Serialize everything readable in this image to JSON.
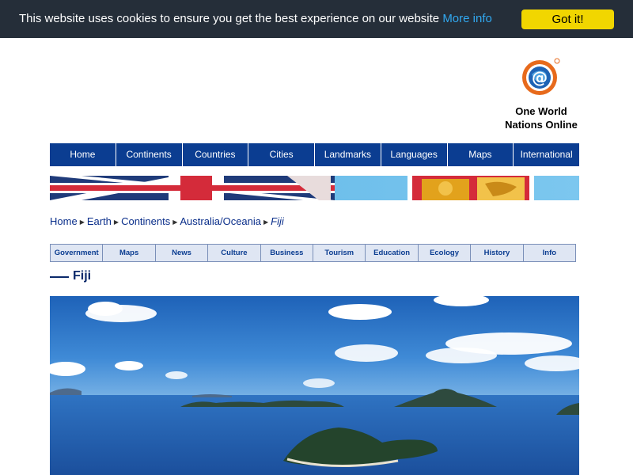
{
  "cookie_bar": {
    "message": "This website uses cookies to ensure you get the best experience on our website",
    "more_info": "More info",
    "button": "Got it!"
  },
  "logo": {
    "line1": "One World",
    "line2": "Nations Online"
  },
  "main_nav": [
    "Home",
    "Continents",
    "Countries",
    "Cities",
    "Landmarks",
    "Languages",
    "Maps",
    "International"
  ],
  "breadcrumb": {
    "items": [
      "Home",
      "Earth",
      "Continents",
      "Australia/Oceania"
    ],
    "current": "Fiji"
  },
  "sub_nav": [
    "Government",
    "Maps",
    "News",
    "Culture",
    "Business",
    "Tourism",
    "Education",
    "Ecology",
    "History",
    "Info"
  ],
  "page_title": "Fiji",
  "colors": {
    "cookie_bg": "#252e39",
    "cookie_button": "#f1d600",
    "nav_bg": "#0b3d91",
    "link": "#31a8f0"
  }
}
